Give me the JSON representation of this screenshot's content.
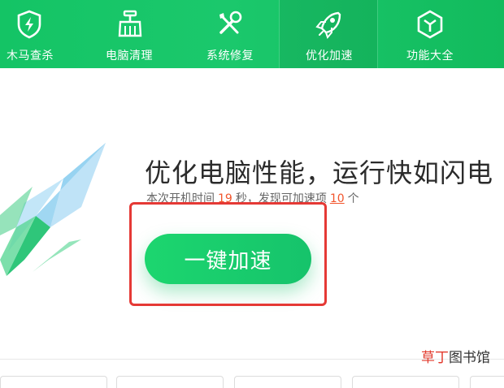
{
  "nav": {
    "tabs": [
      {
        "label": "木马查杀",
        "icon": "shield-bolt-icon"
      },
      {
        "label": "电脑清理",
        "icon": "broom-icon"
      },
      {
        "label": "系统修复",
        "icon": "tools-icon"
      },
      {
        "label": "优化加速",
        "icon": "rocket-icon",
        "active": true
      },
      {
        "label": "功能大全",
        "icon": "cube-icon"
      }
    ]
  },
  "main": {
    "headline": "优化电脑性能，运行快如闪电",
    "boot_prefix": "本次开机时间",
    "boot_seconds": "19",
    "boot_unit": "秒，发现可加速项",
    "items_found": "10",
    "items_unit": "个",
    "button_label": "一键加速"
  },
  "watermark": {
    "accent": "草丁",
    "rest": "图书馆"
  },
  "colors": {
    "brand_green": "#14c465",
    "number_accent": "#f2552c",
    "annotation_red": "#e53935"
  }
}
